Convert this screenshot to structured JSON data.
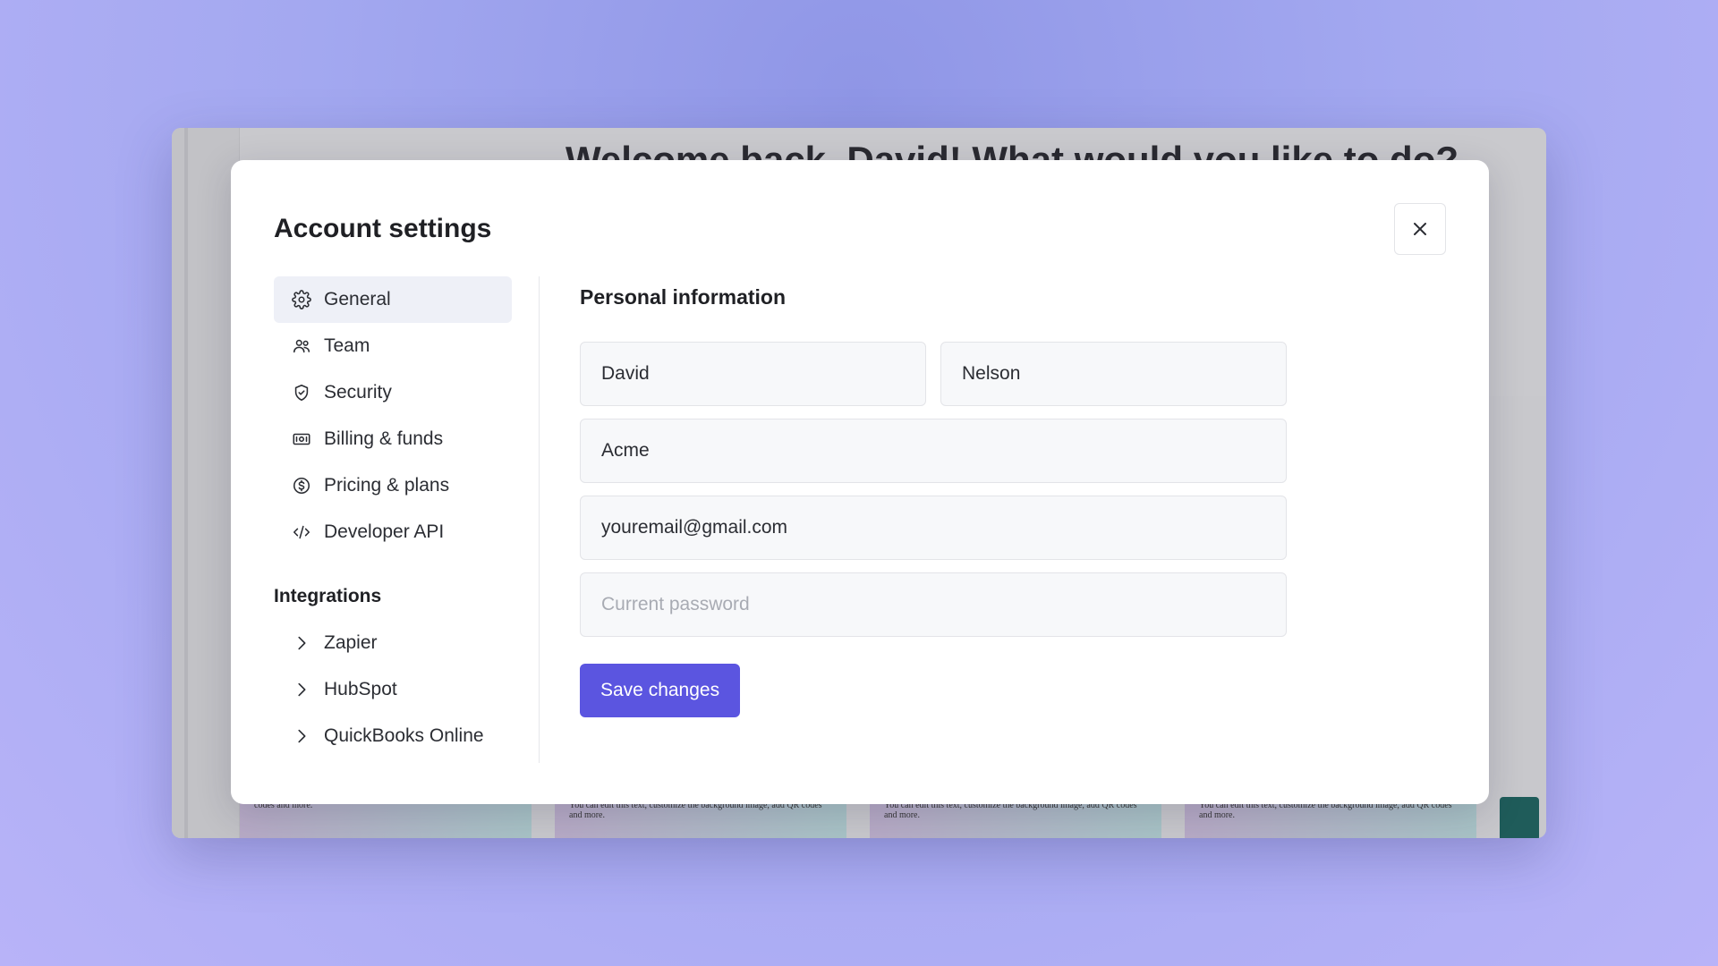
{
  "background": {
    "welcome_text": "Welcome back, David! What would you like to do?",
    "card_text": "You can edit this text, customize the background image, add QR codes and more.",
    "card_text_first": "codes and more."
  },
  "modal": {
    "title": "Account settings",
    "close_label": "×"
  },
  "sidebar": {
    "items": [
      {
        "label": "General",
        "icon": "gear-icon",
        "active": true
      },
      {
        "label": "Team",
        "icon": "team-icon",
        "active": false
      },
      {
        "label": "Security",
        "icon": "shield-icon",
        "active": false
      },
      {
        "label": "Billing & funds",
        "icon": "banknote-icon",
        "active": false
      },
      {
        "label": "Pricing & plans",
        "icon": "dollar-circle-icon",
        "active": false
      },
      {
        "label": "Developer API",
        "icon": "code-icon",
        "active": false
      }
    ],
    "integrations_heading": "Integrations",
    "integrations": [
      {
        "label": "Zapier",
        "icon": "chevron-right-icon"
      },
      {
        "label": "HubSpot",
        "icon": "chevron-right-icon"
      },
      {
        "label": "QuickBooks Online",
        "icon": "chevron-right-icon"
      }
    ]
  },
  "personal_info": {
    "heading": "Personal information",
    "first_name": "David",
    "last_name": "Nelson",
    "company": "Acme",
    "email": "youremail@gmail.com",
    "password_placeholder": "Current password",
    "save_label": "Save changes"
  },
  "colors": {
    "accent": "#5b55e0",
    "active_nav_bg": "#eef0f7"
  }
}
